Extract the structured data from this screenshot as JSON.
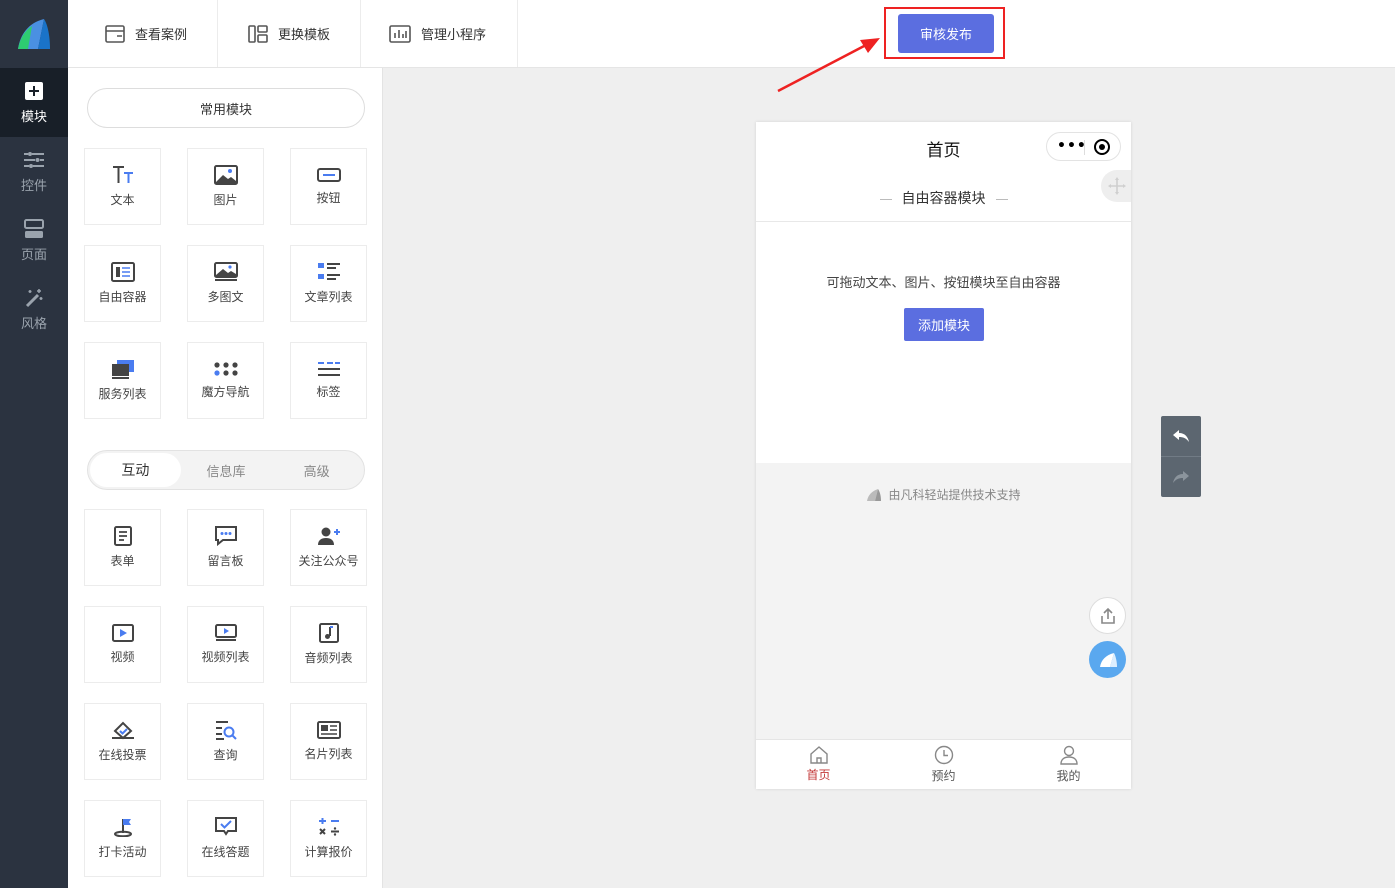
{
  "rail": {
    "items": [
      {
        "label": "模块",
        "icon": "plus-square-icon",
        "active": true
      },
      {
        "label": "控件",
        "icon": "sliders-icon",
        "active": false
      },
      {
        "label": "页面",
        "icon": "page-layout-icon",
        "active": false
      },
      {
        "label": "风格",
        "icon": "magic-wand-icon",
        "active": false
      }
    ]
  },
  "toolbar": {
    "view_cases": "查看案例",
    "change_template": "更换模板",
    "manage_miniprogram": "管理小程序",
    "publish": "审核发布"
  },
  "panel": {
    "common_modules": "常用模块",
    "common_tiles": [
      {
        "label": "文本",
        "icon": "text-icon"
      },
      {
        "label": "图片",
        "icon": "image-icon"
      },
      {
        "label": "按钮",
        "icon": "button-icon"
      },
      {
        "label": "自由容器",
        "icon": "container-icon"
      },
      {
        "label": "多图文",
        "icon": "multi-image-icon"
      },
      {
        "label": "文章列表",
        "icon": "article-list-icon"
      },
      {
        "label": "服务列表",
        "icon": "service-list-icon"
      },
      {
        "label": "魔方导航",
        "icon": "grid-nav-icon"
      },
      {
        "label": "标签",
        "icon": "tag-icon"
      }
    ],
    "tabs": [
      {
        "label": "互动",
        "active": true
      },
      {
        "label": "信息库",
        "active": false
      },
      {
        "label": "高级",
        "active": false
      }
    ],
    "interactive_tiles": [
      {
        "label": "表单",
        "icon": "form-icon"
      },
      {
        "label": "留言板",
        "icon": "message-board-icon"
      },
      {
        "label": "关注公众号",
        "icon": "follow-account-icon"
      },
      {
        "label": "视频",
        "icon": "video-icon"
      },
      {
        "label": "视频列表",
        "icon": "video-list-icon"
      },
      {
        "label": "音频列表",
        "icon": "audio-list-icon"
      },
      {
        "label": "在线投票",
        "icon": "vote-icon"
      },
      {
        "label": "查询",
        "icon": "query-icon"
      },
      {
        "label": "名片列表",
        "icon": "card-list-icon"
      },
      {
        "label": "打卡活动",
        "icon": "checkin-flag-icon"
      },
      {
        "label": "在线答题",
        "icon": "quiz-icon"
      },
      {
        "label": "计算报价",
        "icon": "calculator-icon"
      }
    ]
  },
  "phone": {
    "title": "首页",
    "section_title": "自由容器模块",
    "hint": "可拖动文本、图片、按钮模块至自由容器",
    "add_button": "添加模块",
    "footer": "由凡科轻站提供技术支持",
    "tabs": [
      {
        "label": "首页",
        "icon": "home-icon",
        "active": true
      },
      {
        "label": "预约",
        "icon": "clock-icon",
        "active": false
      },
      {
        "label": "我的",
        "icon": "user-icon",
        "active": false
      }
    ]
  },
  "colors": {
    "accent": "#5b6ee0",
    "rail_bg": "#2b3340",
    "highlight_red": "#ee2222",
    "tab_active": "#c43a3a"
  }
}
